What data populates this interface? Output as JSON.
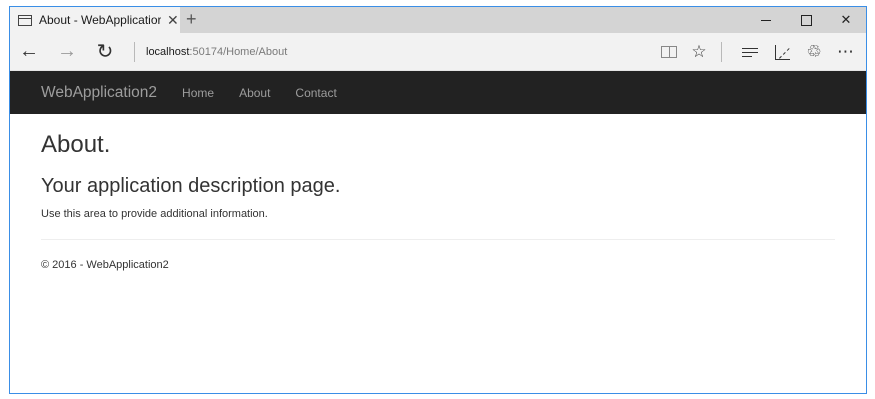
{
  "tab": {
    "title": "About - WebApplicatior",
    "close": "✕",
    "new_tab": "+"
  },
  "window_controls": {
    "close": "✕"
  },
  "address": {
    "back": "←",
    "forward": "→",
    "refresh": "↻",
    "url_host": "localhost",
    "url_path": ":50174/Home/About"
  },
  "toolbar": {
    "favorite": "☆",
    "share": "♲",
    "more": "⋯"
  },
  "navbar": {
    "brand": "WebApplication2",
    "links": [
      "Home",
      "About",
      "Contact"
    ]
  },
  "page": {
    "heading": "About.",
    "subheading": "Your application description page.",
    "paragraph": "Use this area to provide additional information.",
    "footer": "© 2016 - WebApplication2"
  },
  "icons": {
    "tab": "page-icon",
    "reading_view": "book-icon",
    "favorite": "star-icon",
    "hub": "hub-icon",
    "note": "pen-note-icon",
    "share": "share-icon",
    "more": "more-icon"
  },
  "colors": {
    "window_border": "#3a8ee6",
    "navbar_bg": "#222222",
    "navbar_text": "#9d9d9d",
    "tabstrip_bg": "#d4d4d4"
  }
}
